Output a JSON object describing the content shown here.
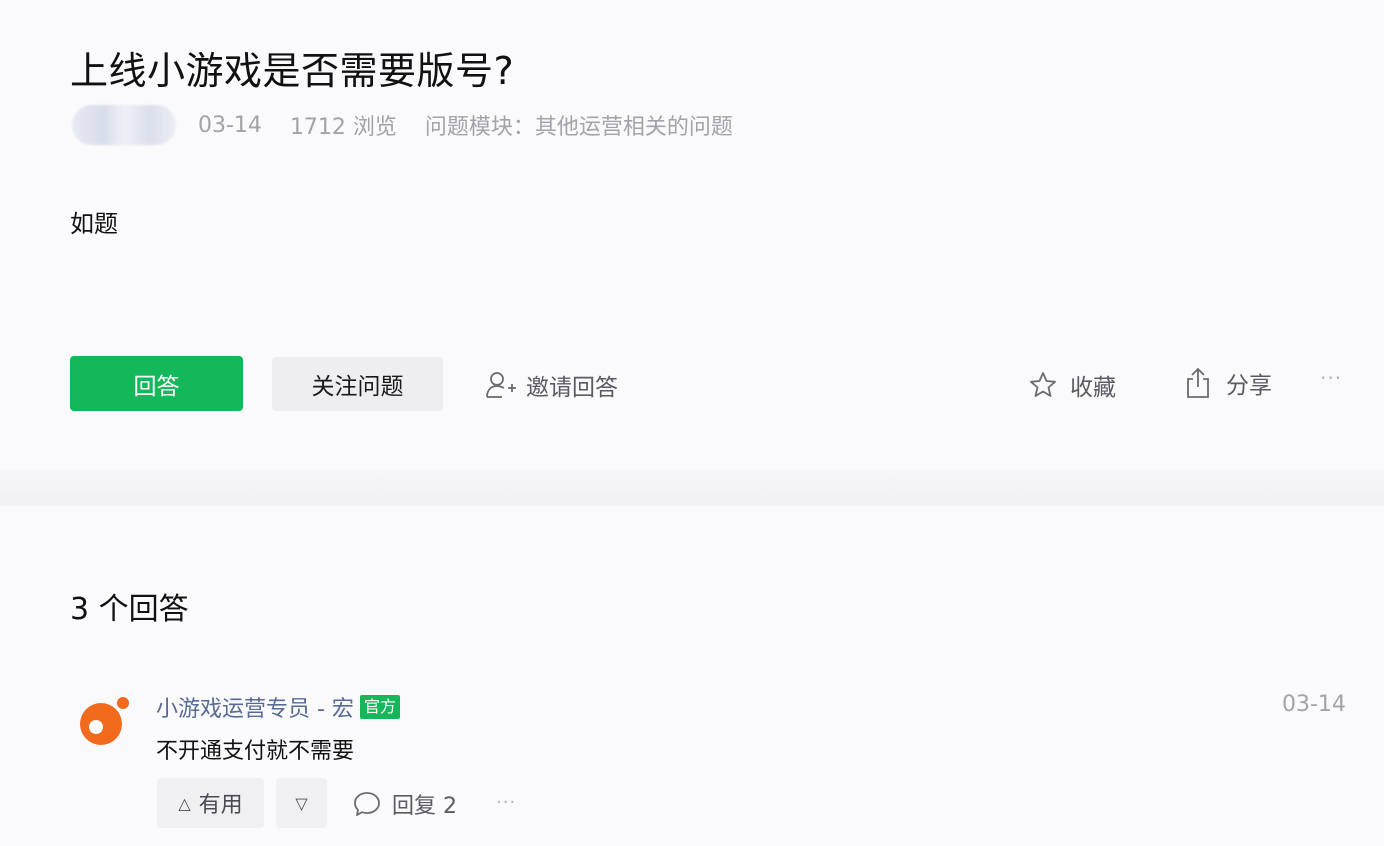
{
  "question": {
    "title": "上线小游戏是否需要版号?",
    "date": "03-14",
    "views": "1712 浏览",
    "module": "问题模块：其他运营相关的问题",
    "body": "如题"
  },
  "actions": {
    "answer_label": "回答",
    "follow_label": "关注问题",
    "invite_label": "邀请回答",
    "collect_label": "收藏",
    "share_label": "分享",
    "more_label": "···"
  },
  "answers": {
    "count_label": "3 个回答",
    "items": [
      {
        "author": "小游戏运营专员 - 宏",
        "badge": "官方",
        "date": "03-14",
        "text": "不开通支付就不需要",
        "useful_label": "有用",
        "useful_icon": "△",
        "down_icon": "▽",
        "reply_label": "回复 2",
        "more_label": "···"
      }
    ]
  },
  "colors": {
    "accent": "#14b85a",
    "link": "#576b95",
    "muted": "#a2a2a8",
    "avatar_orange": "#f26b1d"
  }
}
